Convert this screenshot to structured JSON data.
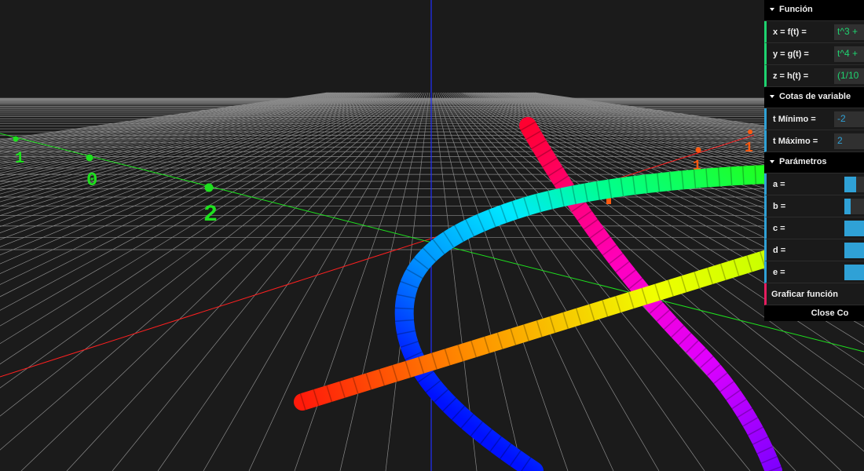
{
  "gui": {
    "folders": [
      {
        "title": "Función",
        "controls": [
          {
            "label": "x = f(t) =",
            "value": "t^3 +"
          },
          {
            "label": "y = g(t) =",
            "value": "t^4 +"
          },
          {
            "label": "z = h(t) =",
            "value": "(1/10"
          }
        ]
      },
      {
        "title": "Cotas de variable",
        "controls": [
          {
            "label": "t Mínimo =",
            "value": "-2"
          },
          {
            "label": "t Máximo =",
            "value": "2"
          }
        ]
      },
      {
        "title": "Parámetros",
        "controls": [
          {
            "label": "a =",
            "fraction": 0.6
          },
          {
            "label": "b =",
            "fraction": 0.3
          },
          {
            "label": "c =",
            "fraction": 1.0
          },
          {
            "label": "d =",
            "fraction": 1.0
          },
          {
            "label": "e =",
            "fraction": 1.0
          }
        ]
      }
    ],
    "graph_button": "Graficar función",
    "close_button": "Close Co"
  },
  "scene": {
    "axis_labels": {
      "z_axis": [
        "1",
        "0",
        "2"
      ],
      "x_axis": [
        "1",
        "1"
      ]
    },
    "colors": {
      "background": "#1b1b1b",
      "grid": "#8a8a8a",
      "axis_x": "#ff2020",
      "axis_y": "#1ee01e",
      "axis_z": "#2030ff",
      "label_green": "#1ee01e",
      "label_orange": "#ff5a10"
    }
  }
}
